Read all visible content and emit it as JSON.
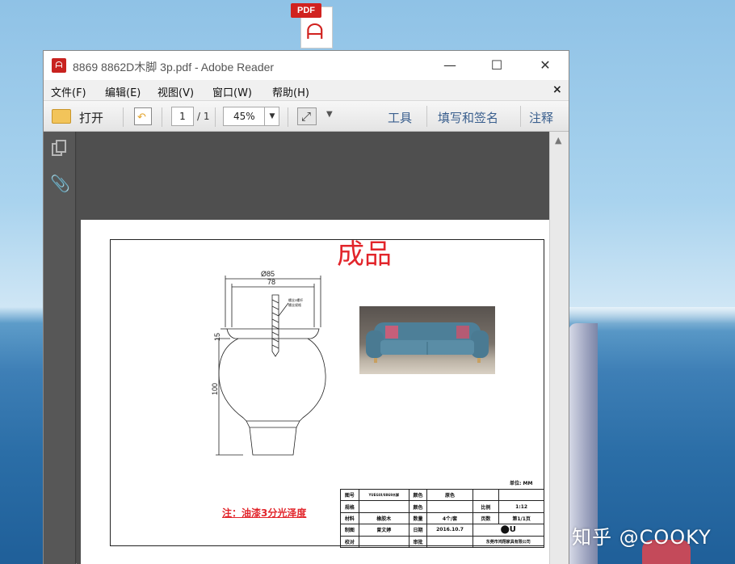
{
  "desktop": {
    "icon_badge": "PDF",
    "watermark": "知乎 @COOKY"
  },
  "window": {
    "title": "8869  8862D木脚 3p.pdf - Adobe Reader",
    "controls": {
      "minimize": "—",
      "maximize": "☐",
      "close": "✕"
    }
  },
  "menubar": {
    "items": [
      {
        "label": "文件(F)"
      },
      {
        "label": "编辑(E)"
      },
      {
        "label": "视图(V)"
      },
      {
        "label": "窗口(W)"
      },
      {
        "label": "帮助(H)"
      }
    ],
    "close": "×"
  },
  "toolbar": {
    "open_label": "打开",
    "page_current": "1",
    "page_total": "/ 1",
    "zoom": "45%",
    "tools": "工具",
    "fill_sign": "填写和签名",
    "comment": "注释"
  },
  "document": {
    "title": "成品",
    "drawing": {
      "dim_top_outer": "Ø85",
      "dim_top_inner": "78",
      "dim_side_small": "15",
      "dim_height": "100",
      "callout_line1": "螺丝3螺杆",
      "callout_line2": "螺丝规格"
    },
    "unit": "单位: MM",
    "note": "注：油漆3分光泽度",
    "title_block": {
      "rows": [
        [
          "图号",
          "YUEGUI/8869木脚",
          "颜色",
          "原色",
          "",
          ""
        ],
        [
          "规格",
          "",
          "颜色",
          "",
          "比例",
          "1:12"
        ],
        [
          "材料",
          "橡胶木",
          "数量",
          "4个/套",
          "页数",
          "第1/1页"
        ],
        [
          "制图",
          "曾文婷",
          "日期",
          "2016.10.7",
          "",
          "LOGO"
        ],
        [
          "校对",
          "",
          "审批",
          "",
          "东莞市鸿翔家具有限公司",
          ""
        ]
      ],
      "logo": "⬤U"
    }
  },
  "colors": {
    "accent_red": "#e2252b",
    "toolbar_link": "#3a5f8e"
  }
}
